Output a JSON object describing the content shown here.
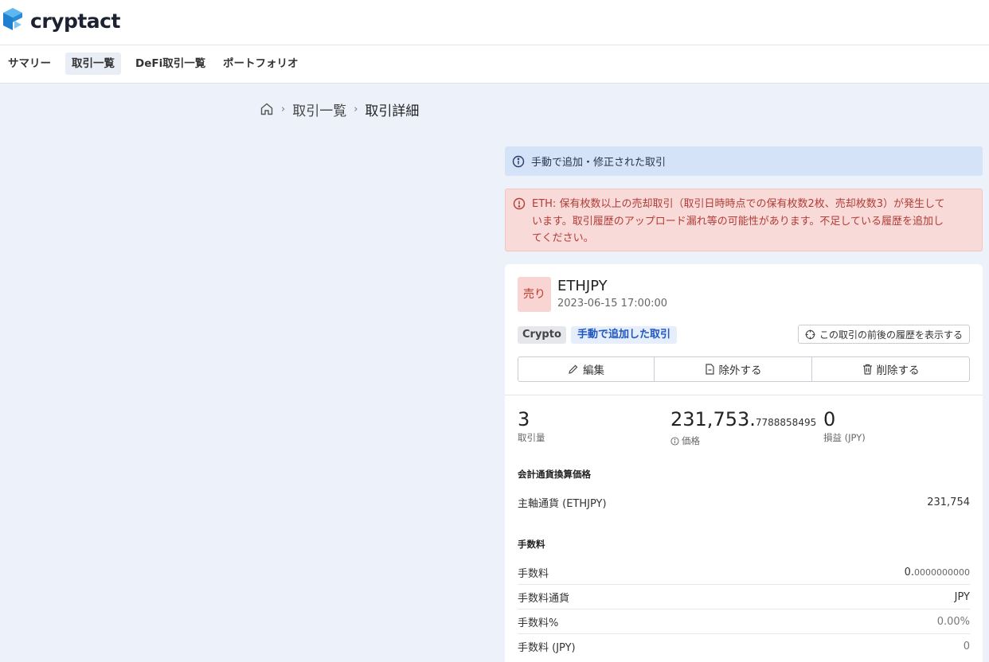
{
  "brand": {
    "name": "cryptact"
  },
  "nav": [
    {
      "label": "サマリー",
      "active": false
    },
    {
      "label": "取引一覧",
      "active": true
    },
    {
      "label": "DeFi取引一覧",
      "active": false
    },
    {
      "label": "ポートフォリオ",
      "active": false
    }
  ],
  "breadcrumb": {
    "list": "取引一覧",
    "current": "取引詳細"
  },
  "alerts": {
    "info": "手動で追加・修正された取引",
    "error_line1": "ETH: 保有枚数以上の売却取引（取引日時時点での保有枚数2枚、売却枚数3）が発生して",
    "error_line2": "います。取引履歴のアップロード漏れ等の可能性があります。不足している履歴を追加し",
    "error_line3": "てください。"
  },
  "trade": {
    "side": "売り",
    "pair": "ETHJPY",
    "datetime": "2023-06-15 17:00:00",
    "tags": {
      "crypto": "Crypto",
      "manual": "手動で追加した取引"
    },
    "history_button": "この取引の前後の履歴を表示する",
    "actions": {
      "edit": "編集",
      "exclude": "除外する",
      "delete": "削除する"
    },
    "stats": {
      "amount": {
        "value": "3",
        "label": "取引量"
      },
      "price": {
        "value_main": "231,753.",
        "value_small": "7788858495",
        "label": "価格"
      },
      "pnl": {
        "value": "0",
        "label": "損益 (JPY)"
      }
    },
    "conversion": {
      "title": "会計通貨換算価格",
      "rows": [
        {
          "label": "主軸通貨 (ETHJPY)",
          "value": "231,754"
        }
      ]
    },
    "fees": {
      "title": "手数料",
      "fee": {
        "label": "手数料",
        "value_main": "0.",
        "value_small": "0000000000"
      },
      "currency": {
        "label": "手数料通貨",
        "value": "JPY"
      },
      "percent": {
        "label": "手数料%",
        "value": "0.00%"
      },
      "jpy": {
        "label": "手数料 (JPY)",
        "value": "0"
      }
    }
  },
  "colors": {
    "accent": "#1f57c3",
    "logo_blue": "#2a8bd8",
    "sell_bg": "#f8d5d2",
    "error_text": "#b23c36",
    "info_bg": "#d5e3f8"
  }
}
